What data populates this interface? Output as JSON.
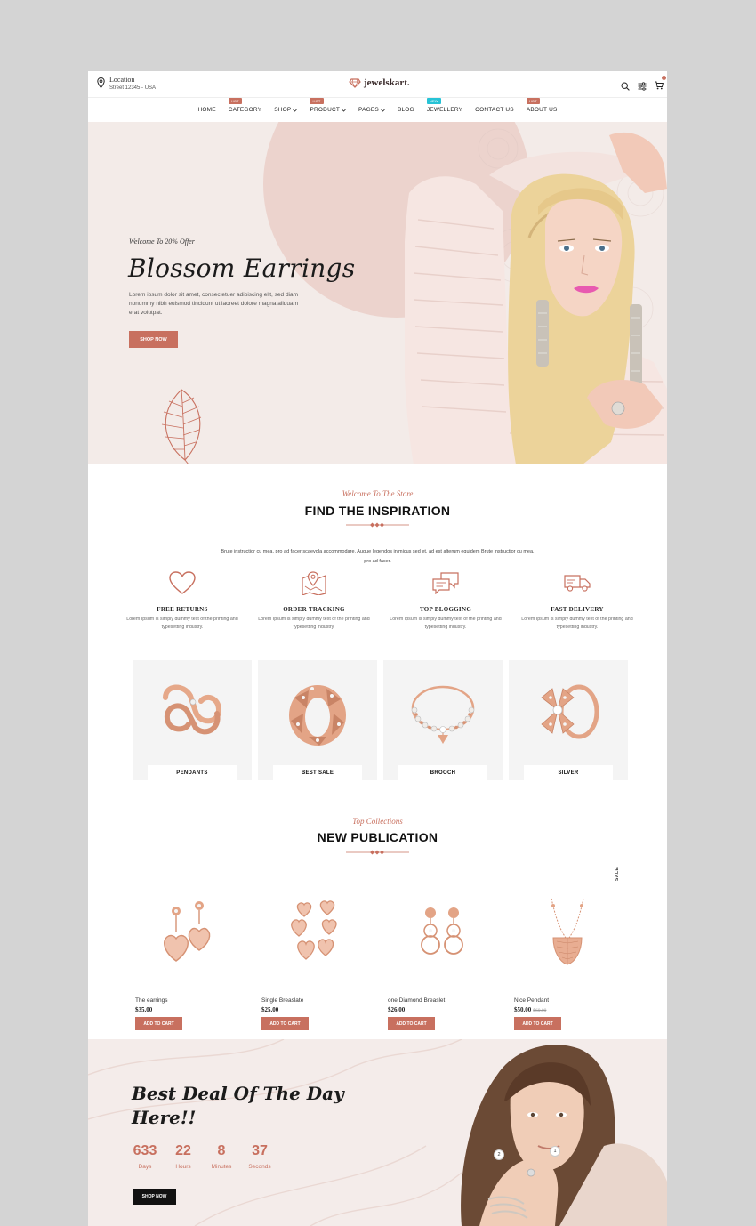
{
  "header": {
    "location_title": "Location",
    "location_sub": "Street 12345 - USA",
    "logo": "jewelskart."
  },
  "nav": {
    "items": [
      {
        "label": "HOME",
        "badge": ""
      },
      {
        "label": "CATEGORY",
        "badge": "HOT"
      },
      {
        "label": "SHOP",
        "badge": ""
      },
      {
        "label": "PRODUCT",
        "badge": "HOT"
      },
      {
        "label": "PAGES",
        "badge": ""
      },
      {
        "label": "BLOG",
        "badge": ""
      },
      {
        "label": "JEWELLERY",
        "badge": "NEW"
      },
      {
        "label": "CONTACT US",
        "badge": ""
      },
      {
        "label": "ABOUT US",
        "badge": "HOT"
      }
    ]
  },
  "hero": {
    "welcome": "Welcome To 20% Offer",
    "title": "Blossom Earrings",
    "text": "Lorem ipsum dolor sit amet, consectetuer adipiscing elit, sed diam nonummy nibh euismod tincidunt ut laoreet dolore magna aliquam erat volutpat.",
    "button": "SHOP NOW"
  },
  "inspiration": {
    "subtitle": "Welcome To The Store",
    "title": "FIND THE INSPIRATION",
    "text": "Brute instructior cu mea, pro ad facer scaevola accommodare. Augue legendos inimicus sed et, ad est alterum equidem Brute instructior cu mea, pro ad facer.",
    "features": [
      {
        "title": "FREE RETURNS",
        "text": "Lorem Ipsum is simply dummy text of the printing and typesetting industry.",
        "icon": "heart-icon"
      },
      {
        "title": "ORDER TRACKING",
        "text": "Lorem Ipsum is simply dummy text of the printing and typesetting industry.",
        "icon": "map-pin-icon"
      },
      {
        "title": "TOP BLOGGING",
        "text": "Lorem Ipsum is simply dummy text of the printing and typesetting industry.",
        "icon": "chat-icon"
      },
      {
        "title": "FAST DELIVERY",
        "text": "Lorem Ipsum is simply dummy text of the printing and typesetting industry.",
        "icon": "truck-icon"
      }
    ]
  },
  "categories": [
    {
      "label": "PENDANTS"
    },
    {
      "label": "BEST SALE"
    },
    {
      "label": "BROOCH"
    },
    {
      "label": "SILVER"
    }
  ],
  "publication": {
    "subtitle": "Top Collections",
    "title": "NEW PUBLICATION",
    "sale_label": "SALE",
    "products": [
      {
        "name": "The earrings",
        "price": "$35.00",
        "old_price": "",
        "button": "ADD TO CART"
      },
      {
        "name": "Single Breaslate",
        "price": "$25.00",
        "old_price": "",
        "button": "ADD TO CART"
      },
      {
        "name": "one Diamond Breaslet",
        "price": "$26.00",
        "old_price": "",
        "button": "ADD TO CART"
      },
      {
        "name": "Nice Pendant",
        "price": "$50.00",
        "old_price": "$60.00",
        "button": "ADD TO CART"
      }
    ]
  },
  "deal": {
    "title": "Best Deal Of The Day Here!!",
    "countdown": [
      {
        "value": "633",
        "label": "Days"
      },
      {
        "value": "22",
        "label": "Hours"
      },
      {
        "value": "8",
        "label": "Minutes"
      },
      {
        "value": "37",
        "label": "Seconds"
      }
    ],
    "button": "SHOP NOW",
    "pins": [
      "2",
      "1"
    ]
  },
  "colors": {
    "accent": "#c8705f",
    "hero_bg": "#f3ebe8",
    "circle": "#ecd3cd",
    "new_badge": "#27c3d6"
  }
}
